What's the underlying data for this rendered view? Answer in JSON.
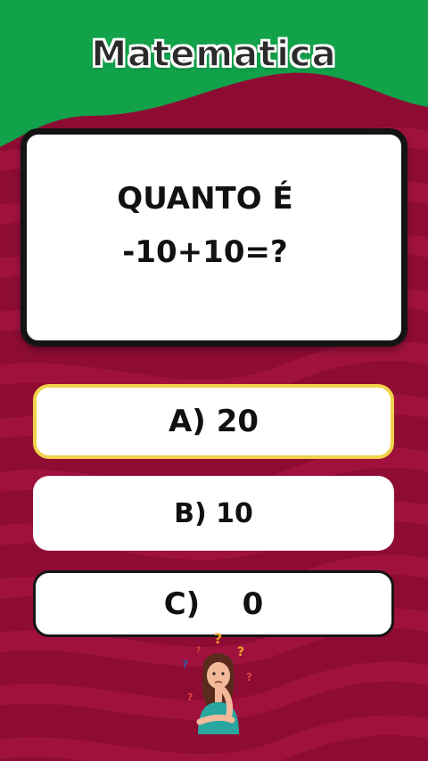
{
  "header": {
    "title": "Matematica"
  },
  "question": {
    "line1": "QUANTO É",
    "line2": "-10+10=?"
  },
  "options": [
    {
      "letter": "A)",
      "value": "20"
    },
    {
      "letter": "B)",
      "value": "10"
    },
    {
      "letter": "C)",
      "value": "0"
    }
  ],
  "colors": {
    "header_green": "#12a24a",
    "background_red": "#8e0c34",
    "stripe_red": "#a4143f",
    "highlight_border": "#f1d24a",
    "card_border": "#141414"
  },
  "illustration": {
    "icon": "thinking-girl-with-question-marks-icon"
  }
}
